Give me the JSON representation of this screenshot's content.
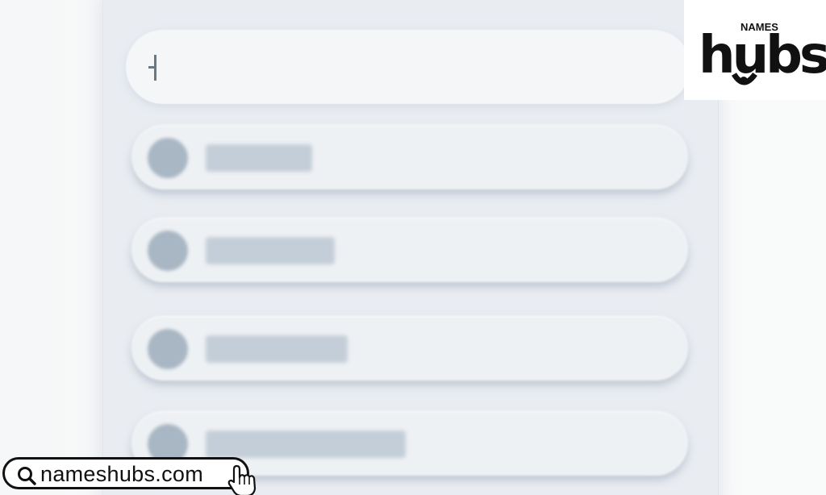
{
  "search": {
    "value": "",
    "placeholder": ""
  },
  "list": {
    "items": [
      {
        "avatar": "avatar-placeholder",
        "text_placeholder_width": 0.33
      },
      {
        "avatar": "avatar-placeholder",
        "text_placeholder_width": 0.4
      },
      {
        "avatar": "avatar-placeholder",
        "text_placeholder_width": 0.44
      },
      {
        "avatar": "avatar-placeholder",
        "text_placeholder_width": 0.62
      }
    ]
  },
  "logo": {
    "small_text": "NAMES",
    "main_text": "hubs"
  },
  "footer": {
    "url": "nameshubs.com",
    "search_icon": "search-icon",
    "cursor_icon": "hand-pointer-icon"
  },
  "colors": {
    "panel": "#e9edf2",
    "item": "#eef1f4",
    "avatar": "#a9b7c4",
    "text_placeholder": "#c4ced8",
    "logo": "#111111"
  }
}
